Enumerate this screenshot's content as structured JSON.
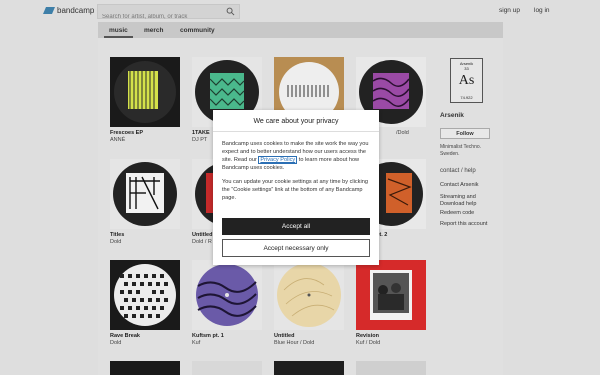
{
  "header": {
    "logo_text": "bandcamp",
    "search_placeholder": "Search for artist, album, or track",
    "signup": "sign up",
    "login": "log in"
  },
  "nav": {
    "tabs": [
      "music",
      "merch",
      "community"
    ]
  },
  "albums": [
    {
      "title": "Frescoes EP",
      "artist": "ANNÉ"
    },
    {
      "title": "1TAKE",
      "artist": "DJ PT"
    },
    {
      "title": "",
      "artist": ""
    },
    {
      "title": "",
      "artist": "/Dold"
    },
    {
      "title": "Titles",
      "artist": "Dold"
    },
    {
      "title": "Untitled",
      "artist": "Dold / R"
    },
    {
      "title": "",
      "artist": ""
    },
    {
      "title": "pt. 2",
      "artist": ""
    },
    {
      "title": "Rave Break",
      "artist": "Dold"
    },
    {
      "title": "Kuftsm pt. 1",
      "artist": "Kuf"
    },
    {
      "title": "Untitled",
      "artist": "Blue Hour / Dold"
    },
    {
      "title": "Revision",
      "artist": "Kuf / Dold"
    }
  ],
  "sidebar": {
    "element": {
      "name": "Arsenik",
      "number": "33",
      "symbol": "As",
      "mass": "74.922"
    },
    "artist_name": "Arsenik",
    "follow_label": "Follow",
    "bio": "Minimalist Techno. Sweden.",
    "contact_help": "contact / help",
    "contact_artist": "Contact Arsenik",
    "streaming": "Streaming and Download help",
    "redeem": "Redeem code",
    "report": "Report this account"
  },
  "cookie_modal": {
    "title": "We care about your privacy",
    "para1_before": "Bandcamp uses cookies to make the site work the way you expect and to better understand how our users access the site. Read our ",
    "privacy_link": "Privacy Policy",
    "para1_after": " to learn more about how Bandcamp uses cookies.",
    "para2": "You can update your cookie settings at any time by clicking the “Cookie settings” link at the bottom of any Bandcamp page.",
    "accept_all": "Accept all",
    "accept_necessary": "Accept necessary only"
  },
  "colors": {
    "accent_link": "#2b6fb4",
    "logo_blue": "#3e7fa8",
    "page_bg": "#dedede",
    "button_dark": "#222222"
  }
}
